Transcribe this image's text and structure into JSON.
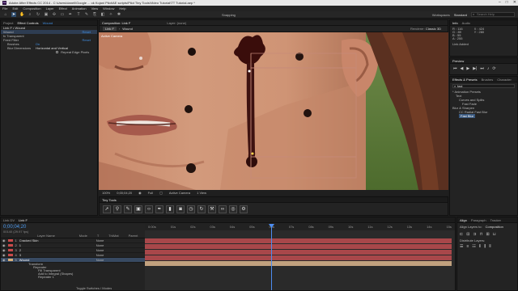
{
  "window": {
    "title": "Adobe After Effects CC 2014 - C:\\Users\\danell\\Google ... ok Kojani Pilot\\AE scripts\\Pilot Tiny Tools\\Video Tutorial\\TT Tutorial.aep *",
    "logo": "Ae",
    "controls": [
      "–",
      "□",
      "✕"
    ]
  },
  "menu": [
    "File",
    "Edit",
    "Composition",
    "Layer",
    "Effect",
    "Animation",
    "View",
    "Window",
    "Help"
  ],
  "toolbar": {
    "tools": [
      "home-icon",
      "select-icon",
      "hand-icon",
      "zoom-icon",
      "rotate-icon",
      "camera-icon",
      "pan-icon",
      "rect-mask-icon",
      "pen-icon",
      "text-icon",
      "brush-icon",
      "clone-icon",
      "eraser-icon",
      "roto-icon",
      "puppet-icon"
    ],
    "snapping_label": "Snapping",
    "workspaces_label": "Workspaces",
    "workspace_value": "Standard",
    "search_placeholder": "Search Help"
  },
  "project_panel": {
    "tabs": [
      "Project",
      "Effect Controls",
      "Wound"
    ],
    "header": "Link F • Wound",
    "rows": [
      {
        "label": "Wound",
        "value": "Reset"
      },
      {
        "label": "fx Transparent",
        "value": ""
      },
      {
        "label": "Feed Filter",
        "value": "Reset"
      },
      {
        "label": "Brushes",
        "value": "On"
      },
      {
        "label": "Blur Dimensions",
        "value": "Horizontal and Vertical"
      },
      {
        "label": "",
        "value": "Repeat Edge Pixels"
      }
    ]
  },
  "composition": {
    "tab_label": "Composition: Link F",
    "layer_tab": "Layer: (none)",
    "subtabs": [
      "Link F",
      "Wound"
    ],
    "renderer": "Renderer:",
    "renderer_value": "Classic 3D",
    "active_camera": "Active Camera",
    "zoom": "100%",
    "timecode": "0;00;04;20",
    "resolution": "Full",
    "camera_view": "Active Camera",
    "views": "1 View"
  },
  "info_panel": {
    "tabs": [
      "Info",
      "Audio"
    ],
    "rgb": [
      "R : 116",
      "G : 89",
      "B : 55",
      "A : 255"
    ],
    "xy": [
      "X : 424",
      "Y : 280"
    ],
    "status": "Link Added"
  },
  "preview_panel": {
    "label": "Preview"
  },
  "effects_panel": {
    "tabs": [
      "Effects & Presets",
      "Brushes",
      "Character"
    ],
    "search": "fast",
    "tree": [
      "* Animation Presets",
      "Text",
      "Curves and Splits",
      "Fast Fade",
      "Blur & Sharpen",
      "CC Radial Fast Blur",
      "Fast Blur"
    ]
  },
  "paint_tools": {
    "title": "Tiny Tools",
    "icons": [
      "tiny-select-icon",
      "tiny-pin-icon",
      "tiny-brush-icon",
      "tiny-frame-icon",
      "tiny-code-icon",
      "tiny-pen-icon",
      "tiny-battery-icon",
      "tiny-camera-icon",
      "tiny-clock-icon",
      "tiny-rotate-icon",
      "tiny-wrench-icon",
      "tiny-link-icon",
      "tiny-target-icon",
      "tiny-gear-icon"
    ]
  },
  "timeline": {
    "tabs": [
      "Link DV",
      "Link F"
    ],
    "timecode": "0;00;04;20",
    "fps": "00140 (29.97 fps)",
    "column_headers": [
      "Layer Name",
      "Mode",
      "T",
      "TrkMat",
      "Parent"
    ],
    "layers": [
      {
        "num": "1",
        "name": "Cracked Skin",
        "parent": "None"
      },
      {
        "num": "2",
        "name": "1",
        "parent": "None"
      },
      {
        "num": "3",
        "name": "2",
        "parent": "None"
      },
      {
        "num": "4",
        "name": "3",
        "parent": "None"
      },
      {
        "num": "5",
        "name": "Wound",
        "parent": "None"
      }
    ],
    "sublayer_rows": [
      "Transform",
      "Repeater",
      "Fill Transparent",
      "Add to Integral (Shapes)",
      "Repeater 1"
    ],
    "ruler": [
      "0:00s",
      "01s",
      "02s",
      "03s",
      "04s",
      "05s",
      "06s",
      "07s",
      "08s",
      "09s",
      "10s",
      "11s",
      "12s",
      "13s",
      "14s",
      "15s"
    ],
    "footer": "Toggle Switches / Modes"
  },
  "align_panel": {
    "tabs": [
      "Align",
      "Paragraph",
      "Tracker"
    ],
    "align_to_label": "Align Layers to:",
    "align_to_value": "Composition",
    "distribute_label": "Distribute Layers:"
  }
}
